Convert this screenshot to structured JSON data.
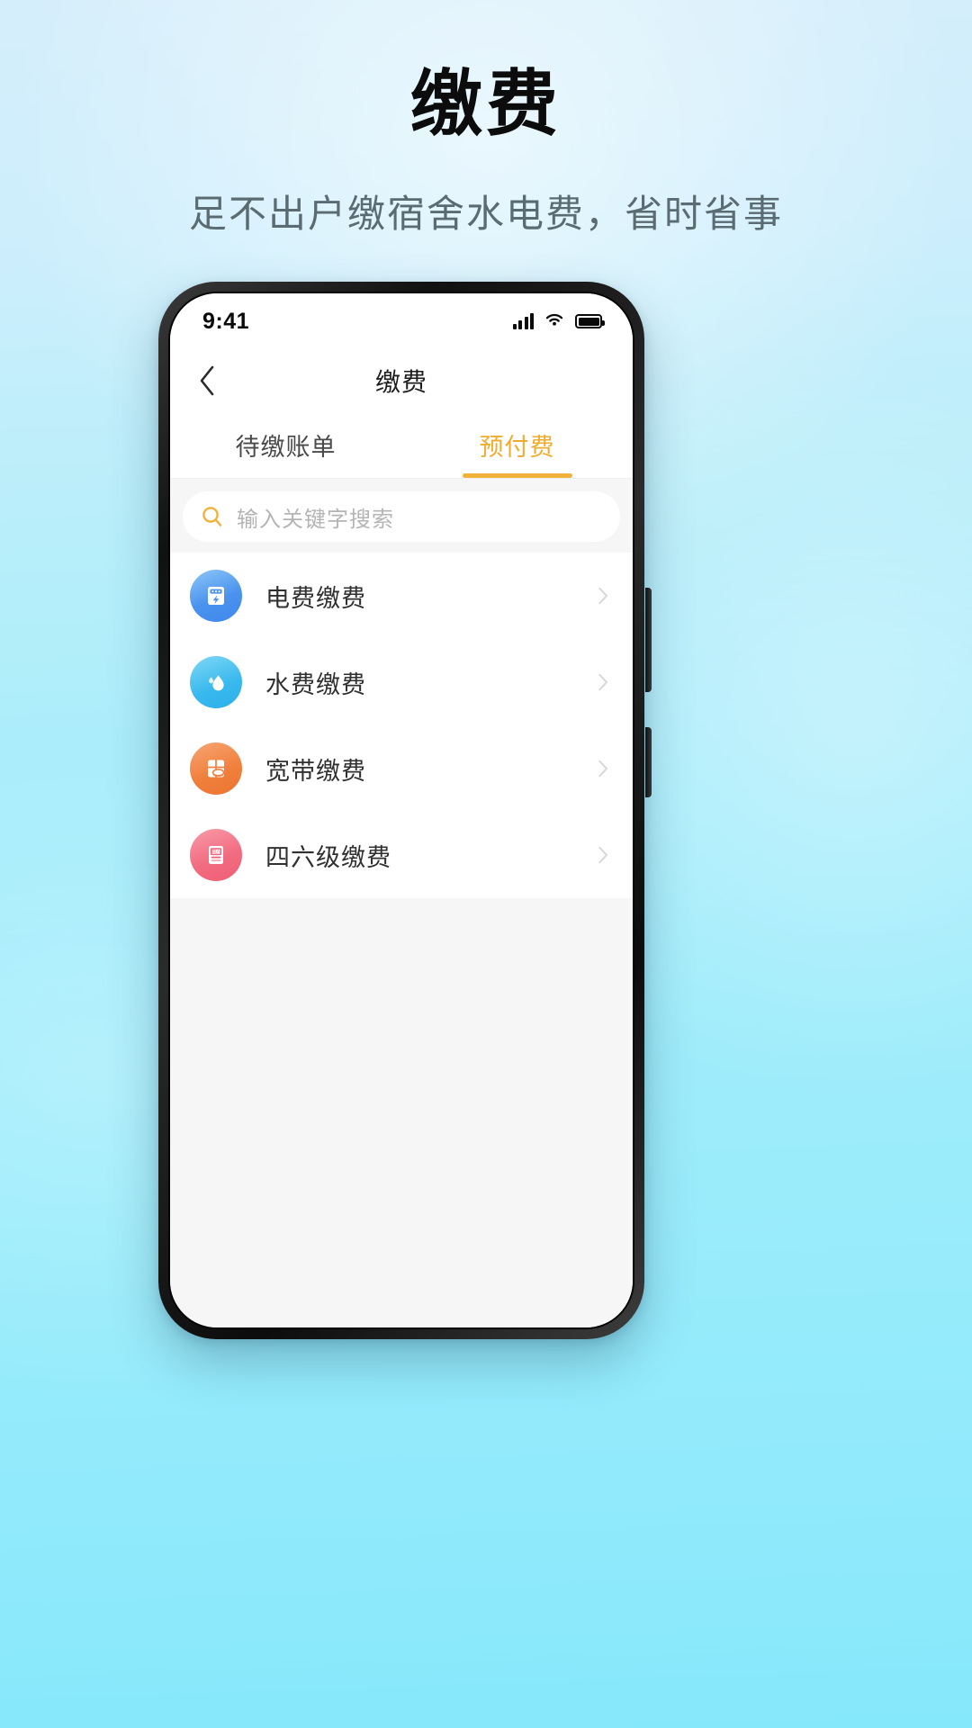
{
  "promo": {
    "title": "缴费",
    "subtitle": "足不出户缴宿舍水电费，省时省事"
  },
  "colors": {
    "accent": "#f0b23a",
    "page_bg_top": "#d5eefb",
    "page_bg_bottom": "#86e8fb",
    "screen_bg": "#f6f6f6",
    "card_bg": "#ffffff",
    "title_text": "#0c0c0c",
    "subtitle_text": "#5b6b72"
  },
  "statusbar": {
    "time": "9:41",
    "signal_icon": "cellular-signal-icon",
    "wifi_icon": "wifi-icon",
    "battery_icon": "battery-icon"
  },
  "navbar": {
    "back_icon": "chevron-left-icon",
    "title": "缴费"
  },
  "tabs": [
    {
      "label": "待缴账单",
      "active": false
    },
    {
      "label": "预付费",
      "active": true
    }
  ],
  "search": {
    "icon": "search-icon",
    "placeholder": "输入关键字搜索",
    "value": ""
  },
  "list": {
    "chevron_icon": "chevron-right-icon",
    "items": [
      {
        "label": "电费缴费",
        "icon": "electricity-meter-icon",
        "icon_class": "ic-elec"
      },
      {
        "label": "水费缴费",
        "icon": "water-drop-icon",
        "icon_class": "ic-water"
      },
      {
        "label": "宽带缴费",
        "icon": "broadband-router-icon",
        "icon_class": "ic-net"
      },
      {
        "label": "四六级缴费",
        "icon": "cet-exam-book-icon",
        "icon_class": "ic-cet"
      }
    ]
  }
}
